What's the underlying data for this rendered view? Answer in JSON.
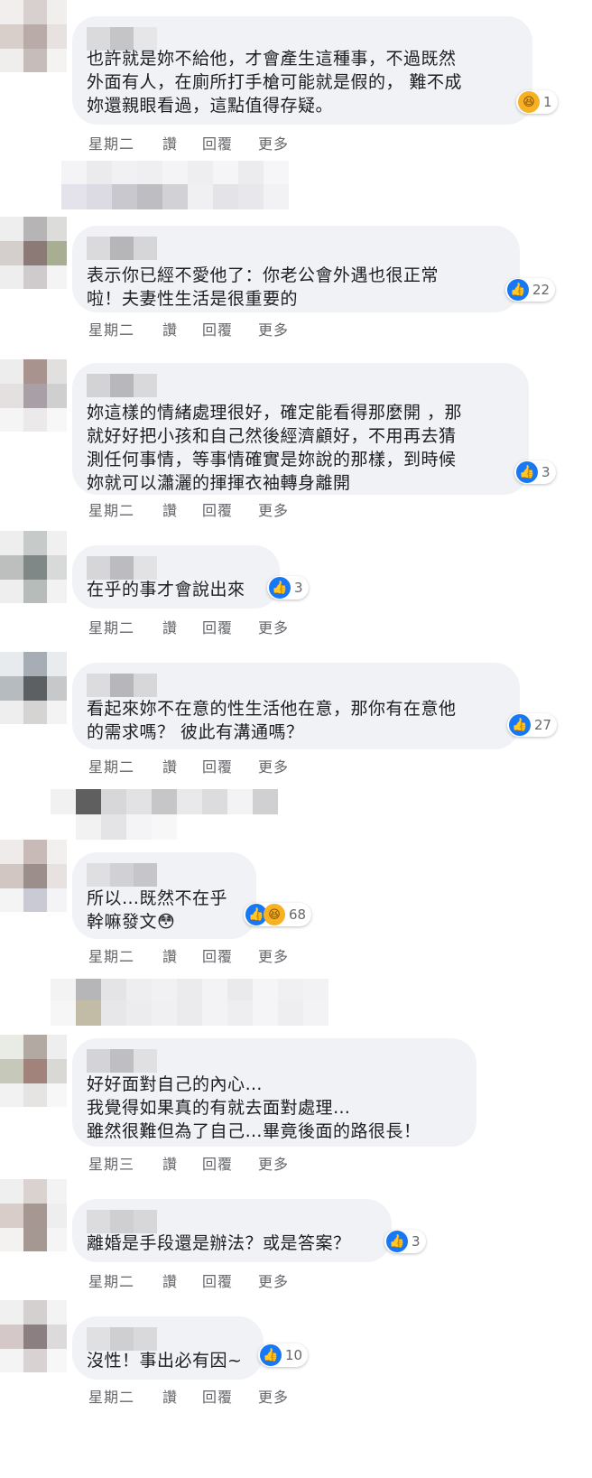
{
  "comments": [
    {
      "text": "也許就是妳不給他，才會產生這種事，不過既然\n外面有人，在廁所打手槍可能就是假的， 難不成\n妳還親眼看過，這點值得存疑。",
      "time": "星期二",
      "like": "讚",
      "reply": "回覆",
      "more": "更多",
      "reactions": [
        "haha"
      ],
      "count": "1"
    },
    {
      "text": "表示你已經不愛他了：你老公會外遇也很正常\n啦！夫妻性生活是很重要的",
      "time": "星期二",
      "like": "讚",
      "reply": "回覆",
      "more": "更多",
      "reactions": [
        "like"
      ],
      "count": "22"
    },
    {
      "text": "妳這樣的情緒處理很好，確定能看得那麼開 ，那\n就好好把小孩和自己然後經濟顧好，不用再去猜\n測任何事情，等事情確實是妳說的那樣，到時候\n妳就可以瀟灑的揮揮衣袖轉身離開",
      "time": "星期二",
      "like": "讚",
      "reply": "回覆",
      "more": "更多",
      "reactions": [
        "like"
      ],
      "count": "3"
    },
    {
      "text": "在乎的事才會說出來",
      "time": "星期二",
      "like": "讚",
      "reply": "回覆",
      "more": "更多",
      "reactions": [
        "like"
      ],
      "count": "3"
    },
    {
      "text": "看起來妳不在意的性生活他在意，那你有在意他\n的需求嗎？ 彼此有溝通嗎？",
      "time": "星期二",
      "like": "讚",
      "reply": "回覆",
      "more": "更多",
      "reactions": [
        "like"
      ],
      "count": "27"
    },
    {
      "text": "所以…既然不在乎\n幹嘛發文😳",
      "time": "星期二",
      "like": "讚",
      "reply": "回覆",
      "more": "更多",
      "reactions": [
        "like",
        "haha"
      ],
      "count": "68"
    },
    {
      "text": "好好面對自己的內心…\n我覺得如果真的有就去面對處理…\n雖然很難但為了自己…畢竟後面的路很長！",
      "time": "星期三",
      "like": "讚",
      "reply": "回覆",
      "more": "更多",
      "reactions": [],
      "count": ""
    },
    {
      "text": "離婚是手段還是辦法？或是答案？",
      "time": "星期二",
      "like": "讚",
      "reply": "回覆",
      "more": "更多",
      "reactions": [
        "like"
      ],
      "count": "3"
    },
    {
      "text": "沒性！事出必有因~",
      "time": "星期二",
      "like": "讚",
      "reply": "回覆",
      "more": "更多",
      "reactions": [
        "like"
      ],
      "count": "10"
    }
  ],
  "colors": {
    "bubble": "#f0f2f5",
    "meta_text": "#65676b",
    "like_blue": "#1877f2",
    "haha_yellow": "#f7b125"
  }
}
